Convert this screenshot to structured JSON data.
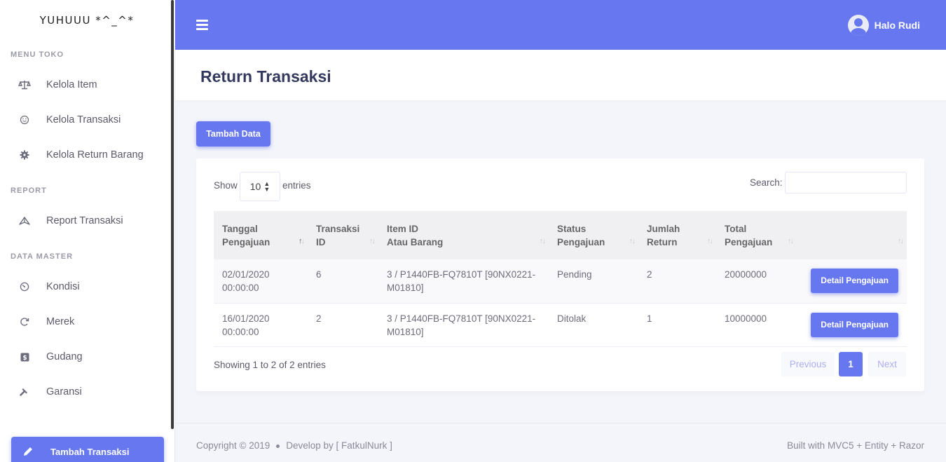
{
  "sidebar": {
    "brand": "YUHUUU *^_^*",
    "sections": {
      "toko": "MENU TOKO",
      "report": "REPORT",
      "master": "DATA MASTER"
    },
    "items": {
      "kelola_item": "Kelola Item",
      "kelola_transaksi": "Kelola Transaksi",
      "kelola_return": "Kelola Return Barang",
      "report_transaksi": "Report Transaksi",
      "kondisi": "Kondisi",
      "merek": "Merek",
      "gudang": "Gudang",
      "garansi": "Garansi"
    },
    "cta": "Tambah Transaksi"
  },
  "topbar": {
    "user_name": "Halo Rudi"
  },
  "page": {
    "title": "Return Transaksi",
    "add_button": "Tambah Data"
  },
  "table_controls": {
    "show": "Show",
    "entries_value": "10",
    "entries": "entries",
    "search_label": "Search:",
    "search_placeholder": ""
  },
  "table": {
    "headers": {
      "tanggal_1": "Tanggal",
      "tanggal_2": "Pengajuan",
      "transaksi_1": "Transaksi",
      "transaksi_2": "ID",
      "item_1": "Item ID",
      "item_2": "Atau Barang",
      "status_1": "Status",
      "status_2": "Pengajuan",
      "jumlah_1": "Jumlah",
      "jumlah_2": "Return",
      "total_1": "Total",
      "total_2": "Pengajuan"
    },
    "rows": [
      {
        "tanggal_1": "02/01/2020",
        "tanggal_2": "00:00:00",
        "transaksi_id": "6",
        "item_1": "3 / P1440FB-FQ7810T [90NX0221-",
        "item_2": "M01810]",
        "status": "Pending",
        "jumlah": "2",
        "total": "20000000",
        "action": "Detail Pengajuan"
      },
      {
        "tanggal_1": "16/01/2020",
        "tanggal_2": "00:00:00",
        "transaksi_id": "2",
        "item_1": "3 / P1440FB-FQ7810T [90NX0221-",
        "item_2": "M01810]",
        "status": "Ditolak",
        "jumlah": "1",
        "total": "10000000",
        "action": "Detail Pengajuan"
      }
    ]
  },
  "pagination": {
    "info": "Showing 1 to 2 of 2 entries",
    "previous": "Previous",
    "current": "1",
    "next": "Next"
  },
  "footer": {
    "copyright": "Copyright © 2019",
    "developer": "Develop by [ FatkulNurk ]",
    "built": "Built with MVC5 + Entity + Razor"
  },
  "colors": {
    "primary": "#6777ef",
    "title": "#34395e"
  }
}
